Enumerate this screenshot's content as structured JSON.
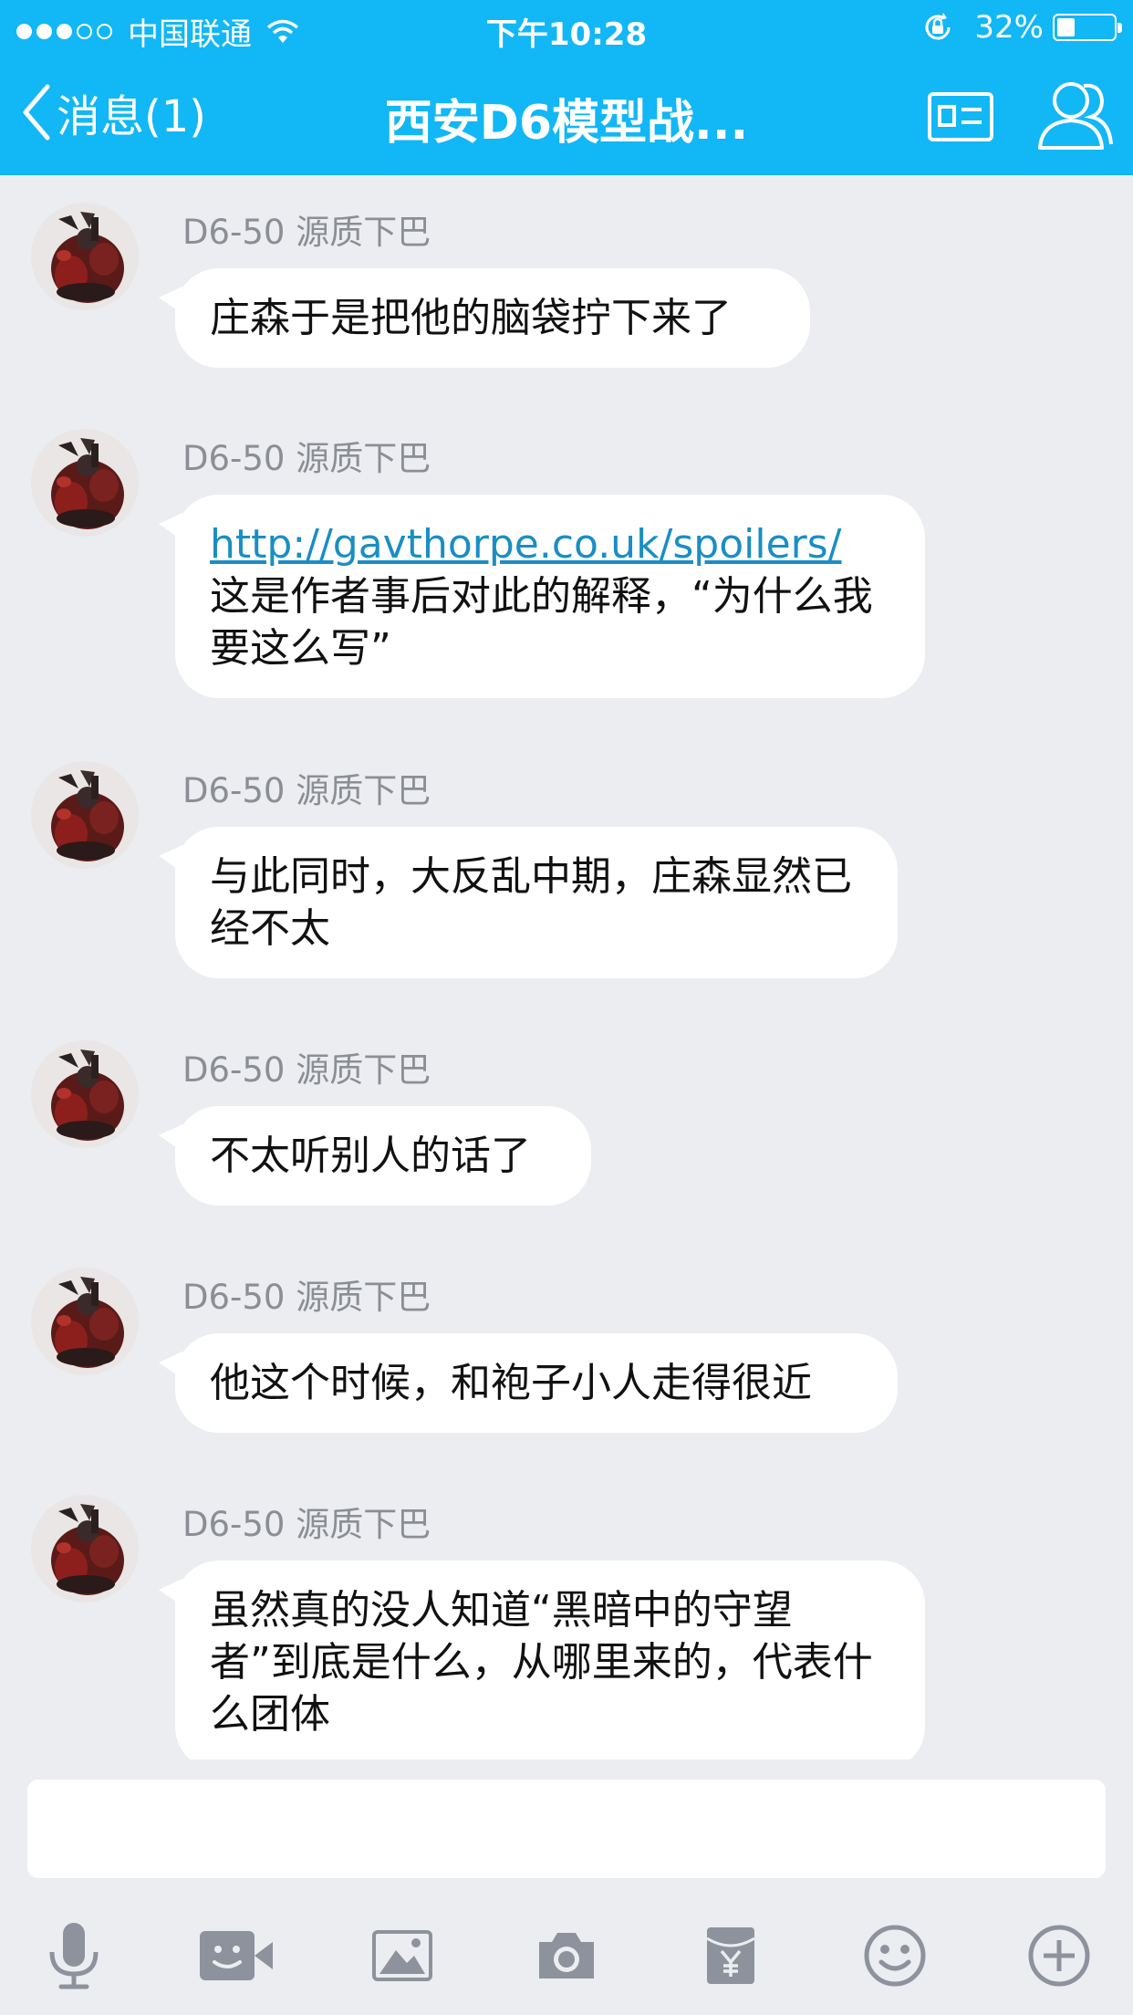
{
  "status_bar": {
    "carrier": "中国联通",
    "time": "下午10:28",
    "battery": "32%",
    "battery_level": 0.32
  },
  "nav": {
    "back_label": "消息(1)",
    "title": "西安D6模型战..."
  },
  "messages": [
    {
      "sender": "D6-50 源质下巴",
      "text": "庄森于是把他的脑袋拧下来了"
    },
    {
      "sender": "D6-50 源质下巴",
      "link": "http://gavthorpe.co.uk/spoilers/",
      "text": "这是作者事后对此的解释，“为什么我要这么写”"
    },
    {
      "sender": "D6-50 源质下巴",
      "text": "与此同时，大反乱中期，庄森显然已经不太"
    },
    {
      "sender": "D6-50 源质下巴",
      "text": "不太听别人的话了"
    },
    {
      "sender": "D6-50 源质下巴",
      "text": "他这个时候，和袍子小人走得很近"
    },
    {
      "sender": "D6-50 源质下巴",
      "text": "虽然真的没人知道“黑暗中的守望者”到底是什么，从哪里来的，代表什么团体"
    }
  ],
  "input": {
    "value": ""
  },
  "toolbar": {
    "icons": [
      "microphone-icon",
      "video-call-icon",
      "image-icon",
      "camera-icon",
      "red-packet-icon",
      "emoji-icon",
      "plus-icon"
    ]
  },
  "colors": {
    "header_bg": "#12b7f5",
    "chat_bg": "#ebedf1",
    "link": "#1a8ec4",
    "icon_gray": "#8d929d"
  }
}
